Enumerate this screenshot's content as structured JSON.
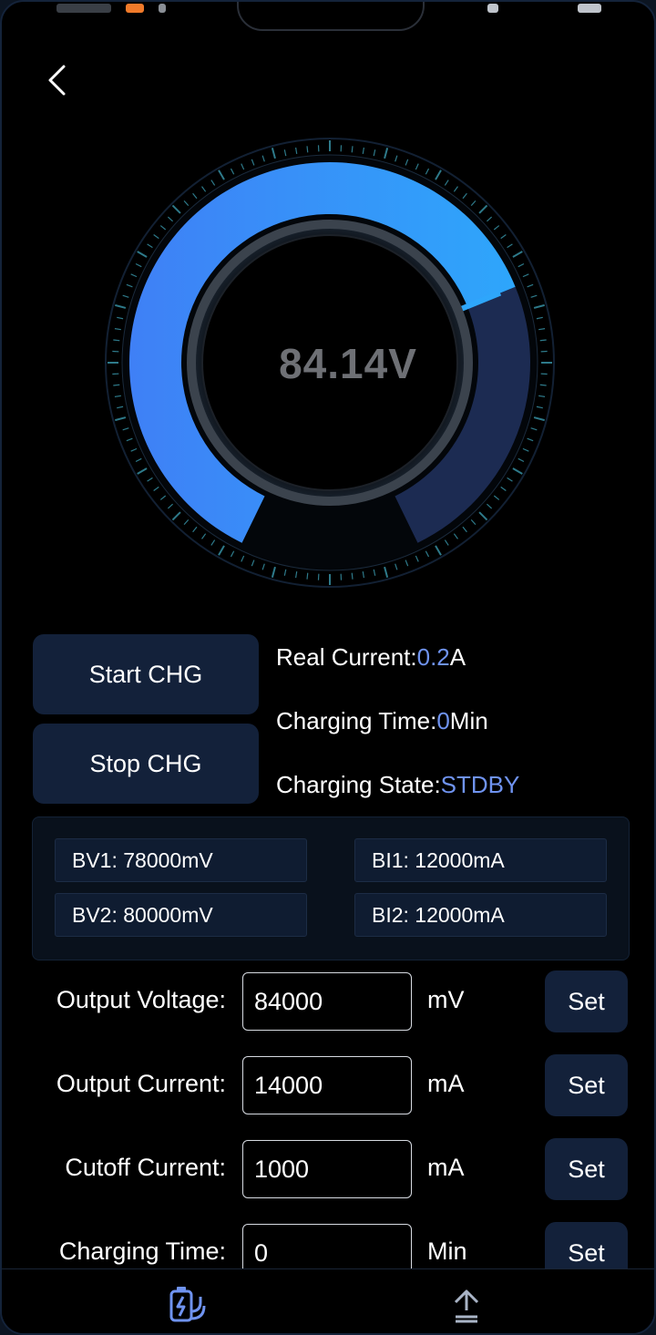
{
  "gauge": {
    "value_text": "84.14V",
    "fill_fraction": 0.72,
    "colors": {
      "start": "#3f80f6",
      "end": "#2ea6fb",
      "remaining": "#1c2b52",
      "ticks": "#2e7a8a"
    }
  },
  "controls": {
    "start_label": "Start CHG",
    "stop_label": "Stop CHG"
  },
  "status": {
    "real_current_label": "Real Current:",
    "real_current_value": "0.2",
    "real_current_unit": "A",
    "charging_time_label": "Charging Time:",
    "charging_time_value": "0",
    "charging_time_unit": "Min",
    "charging_state_label": "Charging State:",
    "charging_state_value": "STDBY"
  },
  "readings": {
    "bv1": "BV1: 78000mV",
    "bi1": "BI1: 12000mA",
    "bv2": "BV2: 80000mV",
    "bi2": "BI2: 12000mA"
  },
  "settings": [
    {
      "label": "Output Voltage:",
      "value": "84000",
      "unit": "mV",
      "button": "Set"
    },
    {
      "label": "Output Current:",
      "value": "14000",
      "unit": "mA",
      "button": "Set"
    },
    {
      "label": "Cutoff Current:",
      "value": "1000",
      "unit": "mA",
      "button": "Set"
    },
    {
      "label": "Charging Time:",
      "value": "0",
      "unit": "Min",
      "button": "Set"
    }
  ],
  "tabs": {
    "charge_icon": "battery-charge-icon",
    "upload_icon": "upload-icon",
    "active_color": "#6f93f0",
    "inactive_color": "#a9b4c6"
  },
  "accent_color": "#6f93f0"
}
